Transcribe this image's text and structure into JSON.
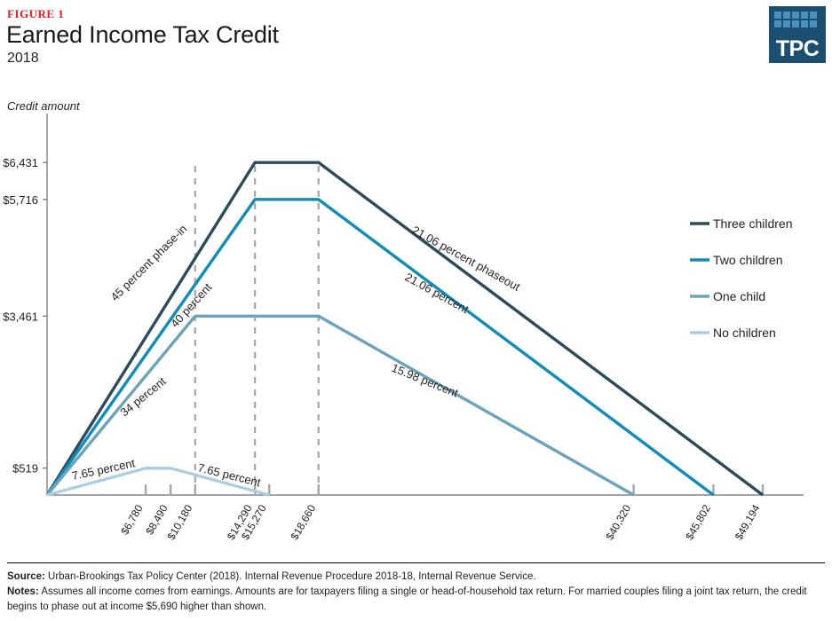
{
  "header": {
    "figure_label": "FIGURE 1",
    "title": "Earned Income Tax Credit",
    "subtitle": "2018"
  },
  "logo": {
    "wordmark": "TPC",
    "background_color": "#1b4f72",
    "tile_color": "#4a90b8",
    "tile_count": 10
  },
  "footer": {
    "source_label": "Source:",
    "source_text": " Urban-Brookings Tax Policy Center (2018). Internal Revenue Procedure 2018-18, Internal Revenue Service.",
    "notes_label": "Notes:",
    "notes_text": " Assumes all income comes from earnings. Amounts are for taxpayers filing a single or head-of-household tax return. For married couples filing a joint tax return, the credit begins to phase out at income $5,690 higher than shown."
  },
  "chart_data": {
    "type": "line",
    "title": "Earned Income Tax Credit",
    "subtitle": "2018",
    "xlabel": "",
    "ylabel": "Credit amount",
    "xlim": [
      0,
      52000
    ],
    "ylim": [
      0,
      7000
    ],
    "grid": false,
    "legend_position": "right",
    "ytick_labels": [
      "$6,431",
      "$5,716",
      "$3,461",
      "$519"
    ],
    "ytick_values": [
      6431,
      5716,
      3461,
      519
    ],
    "xtick_labels": [
      "$6,780",
      "$8,490",
      "$10,180",
      "$14,290",
      "$15,270",
      "$18,660",
      "$40,320",
      "$45,802",
      "$49,194"
    ],
    "xtick_values": [
      6780,
      8490,
      10180,
      14290,
      15270,
      18660,
      40320,
      45802,
      49194
    ],
    "dashed_guides": [
      10180,
      14290,
      18660
    ],
    "series": [
      {
        "name": "Three children",
        "color": "#2b4b5c",
        "x": [
          0,
          14290,
          18660,
          49194
        ],
        "y": [
          0,
          6431,
          6431,
          0
        ],
        "phase_in_rate": 45,
        "phase_out_rate": 21.06
      },
      {
        "name": "Two children",
        "color": "#0f8cb8",
        "x": [
          0,
          14290,
          18660,
          45802
        ],
        "y": [
          0,
          5716,
          5716,
          0
        ],
        "phase_in_rate": 40,
        "phase_out_rate": 21.06
      },
      {
        "name": "One child",
        "color": "#6ba3bd",
        "x": [
          0,
          10180,
          18660,
          40320
        ],
        "y": [
          0,
          3461,
          3461,
          0
        ],
        "phase_in_rate": 34,
        "phase_out_rate": 15.98
      },
      {
        "name": "No children",
        "color": "#a9cfe0",
        "x": [
          0,
          6780,
          8490,
          15270
        ],
        "y": [
          0,
          519,
          519,
          0
        ],
        "phase_in_rate": 7.65,
        "phase_out_rate": 7.65
      }
    ],
    "annotations": [
      {
        "text": "45 percent phase-in",
        "x": 130,
        "y": 340,
        "rotate": -45
      },
      {
        "text": "40 percent",
        "x": 198,
        "y": 370,
        "rotate": -48
      },
      {
        "text": "34 percent",
        "x": 140,
        "y": 470,
        "rotate": -39
      },
      {
        "text": "7.65 percent",
        "x": 82,
        "y": 541,
        "rotate": -12
      },
      {
        "text": "7.65 percent",
        "x": 222,
        "y": 531,
        "rotate": 14
      },
      {
        "text": "21.06 percent phaseout",
        "x": 463,
        "y": 262,
        "rotate": 29
      },
      {
        "text": "21.06 percent",
        "x": 455,
        "y": 315,
        "rotate": 29
      },
      {
        "text": "15.98 percent",
        "x": 440,
        "y": 418,
        "rotate": 22
      }
    ]
  },
  "legend": {
    "items": [
      {
        "label": "Three children",
        "color": "#2b4b5c"
      },
      {
        "label": "Two children",
        "color": "#0f8cb8"
      },
      {
        "label": "One child",
        "color": "#6ba3bd"
      },
      {
        "label": "No children",
        "color": "#a9cfe0"
      }
    ]
  }
}
